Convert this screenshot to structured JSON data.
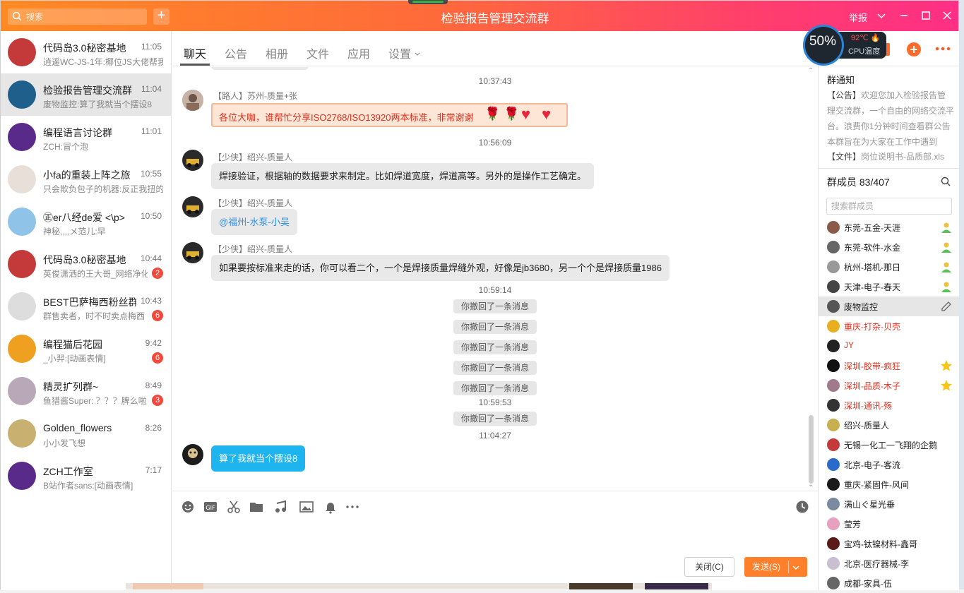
{
  "titlebar": {
    "search_placeholder": "搜索",
    "plus": "+",
    "title": "检验报告管理交流群",
    "report": "举报"
  },
  "conversations": [
    {
      "name": "代码岛3.0秘密基地",
      "time": "11:05",
      "msg": "逍遥WC-JS-1年:椰位JS大佬帮我",
      "badge": "",
      "active": false
    },
    {
      "name": "检验报告管理交流群",
      "time": "11:04",
      "msg": "废物监控:算了我就当个摆设8",
      "badge": "",
      "active": true
    },
    {
      "name": "编程语言讨论群",
      "time": "11:01",
      "msg": "ZCH:冒个泡",
      "badge": "",
      "active": false
    },
    {
      "name": "小fa的重装上阵之旅",
      "time": "10:55",
      "msg": "只会欺负包子的机器:反正我扭的",
      "badge": "",
      "active": false
    },
    {
      "name": "㊣er八经de爱 <\\p>",
      "time": "10:50",
      "msg": "神秘,,,,メ范儿:早",
      "badge": "",
      "active": false
    },
    {
      "name": "代码岛3.0秘密基地",
      "time": "10:44",
      "msg": "英俊潇洒的王大哥_网络净化",
      "badge": "2",
      "active": false
    },
    {
      "name": "BEST巴萨梅西粉丝群",
      "time": "10:43",
      "msg": "群售卖者，时不时卖点梅西",
      "badge": "6",
      "active": false
    },
    {
      "name": "编程猫后花园",
      "time": "9:42",
      "msg": "_小羿:[动画表情]",
      "badge": "6",
      "active": false
    },
    {
      "name": "精灵扩列群~",
      "time": "8:49",
      "msg": "鱼猎酱Super: ？？？脾么啦",
      "badge": "3",
      "active": false
    },
    {
      "name": "Golden_flowers",
      "time": "8:26",
      "msg": "小小发飞想",
      "badge": "",
      "active": false
    },
    {
      "name": "ZCH工作室",
      "time": "7:17",
      "msg": "B站作者sans:[动画表情]",
      "badge": "",
      "active": false
    }
  ],
  "tabs": [
    "聊天",
    "公告",
    "相册",
    "文件",
    "应用",
    "设置"
  ],
  "chat": {
    "ts1": "10:37:43",
    "sender1": "【路人】苏州-质量+张",
    "msg1": "各位大咖，谁帮忙分享ISO2768/ISO13920两本标准，非常谢谢",
    "ts2": "10:56:09",
    "sender2": "【少侠】绍兴-质量人",
    "msg2": "焊接验证，根据轴的数据要求来制定。比如焊道宽度，焊道高等。另外的是操作工艺确定。",
    "sender3": "【少侠】绍兴-质量人",
    "msg3": "@福州-水泵-小吴",
    "sender4": "【少侠】绍兴-质量人",
    "msg4": "如果要按标准来走的话，你可以看二个，一个是焊接质量焊缝外观，好像是jb3680，另一个个是焊接质量1986",
    "ts3": "10:59:14",
    "recall": "你撤回了一条消息",
    "ts4": "10:59:53",
    "ts5": "11:04:27",
    "msg5": "算了我就当个摆设8"
  },
  "actions": {
    "close": "关闭(C)",
    "send": "发送(S)"
  },
  "notice": {
    "title": "群通知",
    "tag": "【公告】",
    "body": "欢迎您加入检验报告管理交流群，一个自由的网络交流平台。浪费你1分钟时间查看群公告本群旨在为大家在工作中遇到",
    "file_tag": "【文件】",
    "file": "岗位说明书-品质部.xls"
  },
  "members": {
    "title": "群成员 83/407",
    "search_placeholder": "搜索群成员",
    "list": [
      {
        "name": "东莞-五金-天涯",
        "red": false,
        "mark": "admin"
      },
      {
        "name": "东莞-软件-水金",
        "red": false,
        "mark": "admin"
      },
      {
        "name": "杭州-塔机-那日",
        "red": false,
        "mark": "admin"
      },
      {
        "name": "天津-电子-春天",
        "red": false,
        "mark": "admin"
      },
      {
        "name": "废物监控",
        "red": false,
        "mark": "edit"
      },
      {
        "name": "重庆-打杂-贝壳",
        "red": true,
        "mark": ""
      },
      {
        "name": "JY",
        "red": true,
        "mark": ""
      },
      {
        "name": "深圳-胶带-疯狂",
        "red": true,
        "mark": "star"
      },
      {
        "name": "深圳-品质-木子",
        "red": true,
        "mark": "star"
      },
      {
        "name": "深圳-通讯-殇",
        "red": true,
        "mark": ""
      },
      {
        "name": "绍兴-质量人",
        "red": false,
        "mark": ""
      },
      {
        "name": "无锡一化工一飞翔的企鹅",
        "red": false,
        "mark": ""
      },
      {
        "name": "北京-电子-客流",
        "red": false,
        "mark": ""
      },
      {
        "name": "重庆-紧固件-风间",
        "red": false,
        "mark": ""
      },
      {
        "name": "满山ぐ星光垂",
        "red": false,
        "mark": ""
      },
      {
        "name": "莹芳",
        "red": false,
        "mark": ""
      },
      {
        "name": "宝鸡-钛镍材料-鑫哥",
        "red": false,
        "mark": ""
      },
      {
        "name": "北京-医疗器械-李",
        "red": false,
        "mark": ""
      },
      {
        "name": "成都-家具-伍",
        "red": false,
        "mark": ""
      }
    ]
  },
  "cpu": {
    "percent": "50%",
    "temp": "92℃",
    "label": "CPU温度"
  },
  "colors": {
    "titlebar_start": "#ff8a24",
    "titlebar_end": "#ff2f86",
    "send_button": "#ff7f2a",
    "my_bubble": "#1eb4f0",
    "badge": "#f2493c"
  }
}
